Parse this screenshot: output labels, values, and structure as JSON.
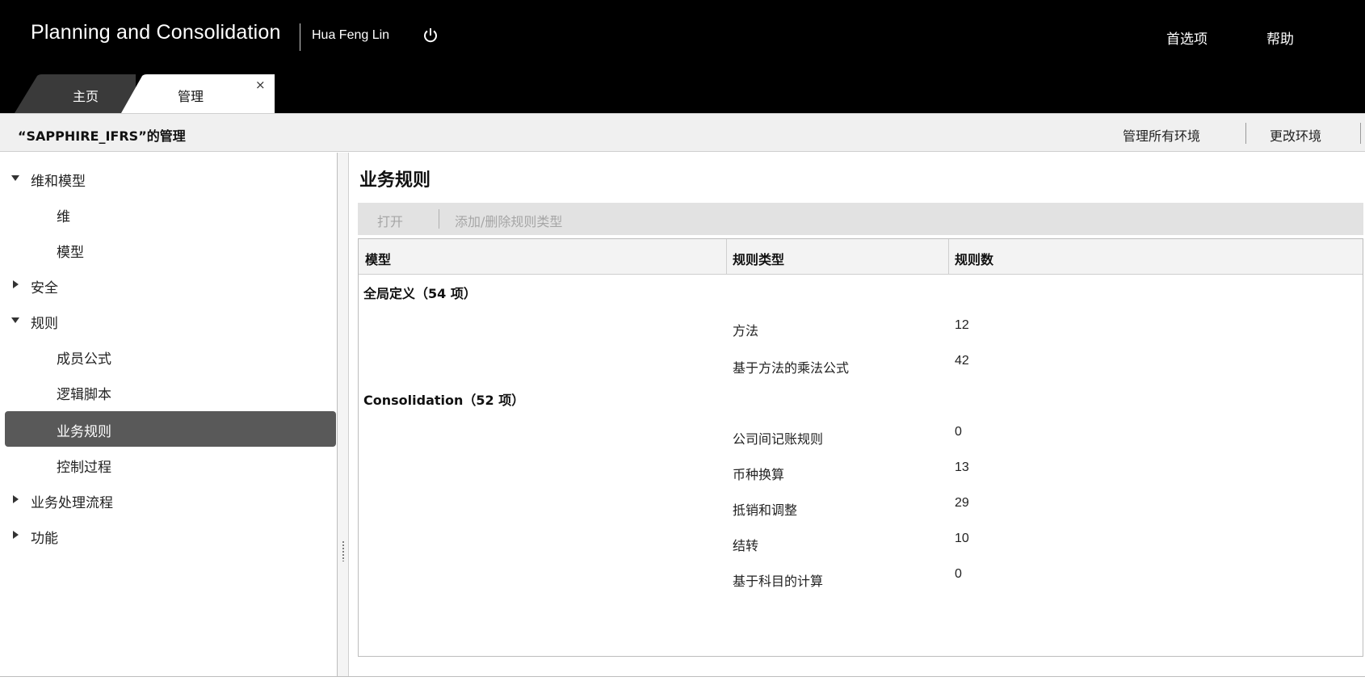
{
  "header": {
    "app_title": "Planning and Consolidation",
    "user_name": "Hua Feng Lin",
    "preferences": "首选项",
    "help": "帮助"
  },
  "tabs": [
    {
      "label": "主页",
      "active": false
    },
    {
      "label": "管理",
      "active": true,
      "close": "×"
    }
  ],
  "subheader": {
    "env_title": "“SAPPHIRE_IFRS”的管理",
    "manage_all": "管理所有环境",
    "change_env": "更改环境"
  },
  "sidebar": {
    "items": [
      {
        "label": "维和模型",
        "level": 1,
        "state": "expanded"
      },
      {
        "label": "维",
        "level": 2
      },
      {
        "label": "模型",
        "level": 2
      },
      {
        "label": "安全",
        "level": 1,
        "state": "collapsed"
      },
      {
        "label": "规则",
        "level": 1,
        "state": "expanded"
      },
      {
        "label": "成员公式",
        "level": 2
      },
      {
        "label": "逻辑脚本",
        "level": 2
      },
      {
        "label": "业务规则",
        "level": 2,
        "active": true
      },
      {
        "label": "控制过程",
        "level": 2
      },
      {
        "label": "业务处理流程",
        "level": 1,
        "state": "collapsed"
      },
      {
        "label": "功能",
        "level": 1,
        "state": "collapsed"
      }
    ]
  },
  "main": {
    "title": "业务规则",
    "toolbar": {
      "open": "打开",
      "add_remove": "添加/删除规则类型"
    },
    "columns": [
      "模型",
      "规则类型",
      "规则数"
    ],
    "groups": [
      {
        "label": "全局定义（54 项）",
        "rows": [
          {
            "type": "方法",
            "count": "12"
          },
          {
            "type": "基于方法的乘法公式",
            "count": "42"
          }
        ]
      },
      {
        "label": "Consolidation（52 项）",
        "rows": [
          {
            "type": "公司间记账规则",
            "count": "0"
          },
          {
            "type": "币种换算",
            "count": "13"
          },
          {
            "type": "抵销和调整",
            "count": "29"
          },
          {
            "type": "结转",
            "count": "10"
          },
          {
            "type": "基于科目的计算",
            "count": "0"
          }
        ]
      }
    ]
  },
  "colors": {
    "topbar": "#000000",
    "active_nav": "#595959",
    "toolbar": "#e2e2e2",
    "disabled_text": "#a6a6a6"
  }
}
